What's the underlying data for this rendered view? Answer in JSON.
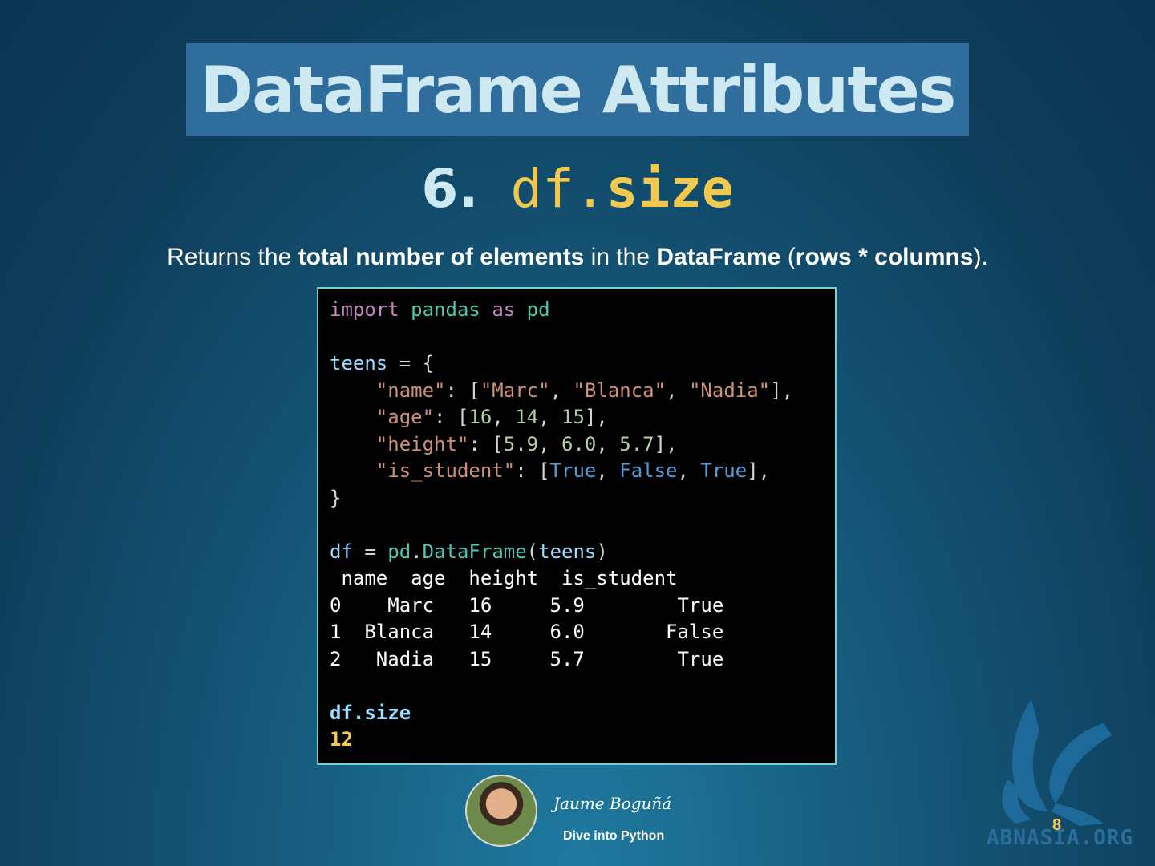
{
  "slide": {
    "title": "DataFrame Attributes",
    "subtitle_number": "6.",
    "subtitle_code_prefix": "df.",
    "subtitle_code_attr": "size",
    "description": {
      "p1": "Returns the ",
      "b1": "total number of elements",
      "p2": " in the ",
      "b2": "DataFrame",
      "p3": " (",
      "b3": "rows * columns",
      "p4": ")."
    },
    "page_number": "8"
  },
  "code": {
    "import_kw": "import",
    "module": "pandas",
    "as_kw": "as",
    "alias": "pd",
    "var_teens": "teens",
    "key_name": "\"name\"",
    "names": [
      "\"Marc\"",
      "\"Blanca\"",
      "\"Nadia\""
    ],
    "key_age": "\"age\"",
    "ages": [
      "16",
      "14",
      "15"
    ],
    "key_height": "\"height\"",
    "heights": [
      "5.9",
      "6.0",
      "5.7"
    ],
    "key_student": "\"is_student\"",
    "students": [
      "True",
      "False",
      "True"
    ],
    "var_df": "df",
    "pd_ref": "pd",
    "ctor": "DataFrame",
    "arg": "teens",
    "table_header": " name  age  height  is_student",
    "table_rows": [
      "0    Marc   16     5.9        True",
      "1  Blanca   14     6.0       False",
      "2   Nadia   15     5.7        True"
    ],
    "size_call": "df.size",
    "size_result": "12"
  },
  "footer": {
    "author": "Jaume Boguñá",
    "course": "Dive into Python",
    "logo_text": "ABNASIA.ORG"
  },
  "colors": {
    "accent_yellow": "#f2c94c",
    "title_band": "#2f6e9c",
    "code_border": "#6fd3d0"
  }
}
